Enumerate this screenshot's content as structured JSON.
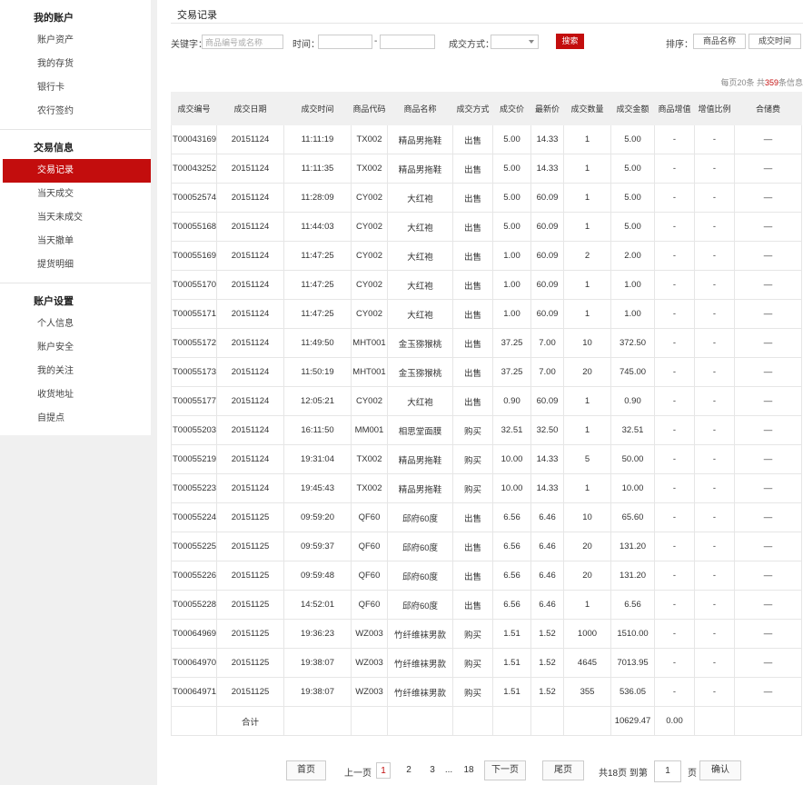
{
  "sidebar": {
    "sections": [
      {
        "title": "我的账户",
        "items": [
          "账户资产",
          "我的存货",
          "银行卡",
          "农行签约"
        ]
      },
      {
        "title": "交易信息",
        "items": [
          "交易记录",
          "当天成交",
          "当天未成交",
          "当天撤单",
          "提货明细"
        ]
      },
      {
        "title": "账户设置",
        "items": [
          "个人信息",
          "账户安全",
          "我的关注",
          "收货地址",
          "自提点"
        ]
      }
    ],
    "active_item": "交易记录"
  },
  "main": {
    "title": "交易记录"
  },
  "filters": {
    "keyword_label": "关键字：",
    "keyword_placeholder": "商品编号或名称",
    "time_label": "时间：",
    "time_sep": "-",
    "method_label": "成交方式：",
    "search_label": "搜索",
    "sort_label": "排序：",
    "sort_by_name": "商品名称",
    "sort_by_time": "成交时间"
  },
  "count_info": {
    "per_page": "每页20条 共",
    "total": "359",
    "suffix": "条信息"
  },
  "table": {
    "headers": [
      "成交编号",
      "成交日期",
      "成交时间",
      "商品代码",
      "商品名称",
      "成交方式",
      "成交价",
      "最新价",
      "成交数量",
      "成交金额",
      "商品增值",
      "增值比例",
      "合储费"
    ],
    "rows": [
      [
        "T00043169",
        "20151124",
        "11:11:19",
        "TX002",
        "精品男拖鞋",
        "出售",
        "5.00",
        "14.33",
        "1",
        "5.00",
        "-",
        "-",
        "—"
      ],
      [
        "T00043252",
        "20151124",
        "11:11:35",
        "TX002",
        "精品男拖鞋",
        "出售",
        "5.00",
        "14.33",
        "1",
        "5.00",
        "-",
        "-",
        "—"
      ],
      [
        "T00052574",
        "20151124",
        "11:28:09",
        "CY002",
        "大红袍",
        "出售",
        "5.00",
        "60.09",
        "1",
        "5.00",
        "-",
        "-",
        "—"
      ],
      [
        "T00055168",
        "20151124",
        "11:44:03",
        "CY002",
        "大红袍",
        "出售",
        "5.00",
        "60.09",
        "1",
        "5.00",
        "-",
        "-",
        "—"
      ],
      [
        "T00055169",
        "20151124",
        "11:47:25",
        "CY002",
        "大红袍",
        "出售",
        "1.00",
        "60.09",
        "2",
        "2.00",
        "-",
        "-",
        "—"
      ],
      [
        "T00055170",
        "20151124",
        "11:47:25",
        "CY002",
        "大红袍",
        "出售",
        "1.00",
        "60.09",
        "1",
        "1.00",
        "-",
        "-",
        "—"
      ],
      [
        "T00055171",
        "20151124",
        "11:47:25",
        "CY002",
        "大红袍",
        "出售",
        "1.00",
        "60.09",
        "1",
        "1.00",
        "-",
        "-",
        "—"
      ],
      [
        "T00055172",
        "20151124",
        "11:49:50",
        "MHT001",
        "金玉猕猴桃",
        "出售",
        "37.25",
        "7.00",
        "10",
        "372.50",
        "-",
        "-",
        "—"
      ],
      [
        "T00055173",
        "20151124",
        "11:50:19",
        "MHT001",
        "金玉猕猴桃",
        "出售",
        "37.25",
        "7.00",
        "20",
        "745.00",
        "-",
        "-",
        "—"
      ],
      [
        "T00055177",
        "20151124",
        "12:05:21",
        "CY002",
        "大红袍",
        "出售",
        "0.90",
        "60.09",
        "1",
        "0.90",
        "-",
        "-",
        "—"
      ],
      [
        "T00055203",
        "20151124",
        "16:11:50",
        "MM001",
        "相思堂面膜",
        "购买",
        "32.51",
        "32.50",
        "1",
        "32.51",
        "-",
        "-",
        "—"
      ],
      [
        "T00055219",
        "20151124",
        "19:31:04",
        "TX002",
        "精品男拖鞋",
        "购买",
        "10.00",
        "14.33",
        "5",
        "50.00",
        "-",
        "-",
        "—"
      ],
      [
        "T00055223",
        "20151124",
        "19:45:43",
        "TX002",
        "精品男拖鞋",
        "购买",
        "10.00",
        "14.33",
        "1",
        "10.00",
        "-",
        "-",
        "—"
      ],
      [
        "T00055224",
        "20151125",
        "09:59:20",
        "QF60",
        "邱府60度",
        "出售",
        "6.56",
        "6.46",
        "10",
        "65.60",
        "-",
        "-",
        "—"
      ],
      [
        "T00055225",
        "20151125",
        "09:59:37",
        "QF60",
        "邱府60度",
        "出售",
        "6.56",
        "6.46",
        "20",
        "131.20",
        "-",
        "-",
        "—"
      ],
      [
        "T00055226",
        "20151125",
        "09:59:48",
        "QF60",
        "邱府60度",
        "出售",
        "6.56",
        "6.46",
        "20",
        "131.20",
        "-",
        "-",
        "—"
      ],
      [
        "T00055228",
        "20151125",
        "14:52:01",
        "QF60",
        "邱府60度",
        "出售",
        "6.56",
        "6.46",
        "1",
        "6.56",
        "-",
        "-",
        "—"
      ],
      [
        "T00064969",
        "20151125",
        "19:36:23",
        "WZ003",
        "竹纤维袜男款",
        "购买",
        "1.51",
        "1.52",
        "1000",
        "1510.00",
        "-",
        "-",
        "—"
      ],
      [
        "T00064970",
        "20151125",
        "19:38:07",
        "WZ003",
        "竹纤维袜男款",
        "购买",
        "1.51",
        "1.52",
        "4645",
        "7013.95",
        "-",
        "-",
        "—"
      ],
      [
        "T00064971",
        "20151125",
        "19:38:07",
        "WZ003",
        "竹纤维袜男款",
        "购买",
        "1.51",
        "1.52",
        "355",
        "536.05",
        "-",
        "-",
        "—"
      ]
    ],
    "total_row": {
      "label": "合计",
      "amount": "10629.47",
      "value_add": "0.00"
    }
  },
  "pager": {
    "first": "首页",
    "prev": "上一页",
    "pages": [
      "1",
      "2",
      "3"
    ],
    "ellipsis": "...",
    "last_page": "18",
    "next": "下一页",
    "last": "尾页",
    "total_text": "共18页 到第",
    "goto_value": "1",
    "page_unit": "页",
    "confirm": "确认"
  },
  "colors": {
    "accent": "#c30d0d",
    "header_bg": "#f0f0f0",
    "page_bg": "#f0f0f0"
  }
}
